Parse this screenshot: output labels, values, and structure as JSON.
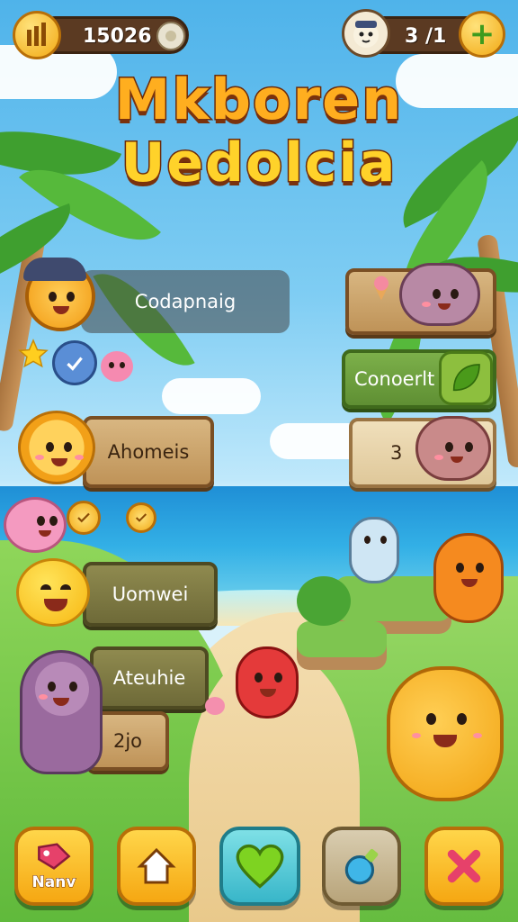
{
  "hud": {
    "coins": "15026",
    "lives": "3 /1",
    "add_symbol": "+",
    "bars_icon": "bars-icon",
    "coin_icon": "coin-icon",
    "avatar_icon": "cat-avatar-icon"
  },
  "title": {
    "line1": "Mkboren",
    "line2": "Uedolcia"
  },
  "menu_left": [
    {
      "label": "Codapnaig"
    },
    {
      "label": "Ahomeis"
    },
    {
      "label": "Uomwei"
    },
    {
      "label": "Ateuhie"
    },
    {
      "label": "2jo"
    }
  ],
  "menu_right": [
    {
      "label": ""
    },
    {
      "label": "Conoerlt"
    },
    {
      "label": "3"
    }
  ],
  "bottom_bar": {
    "new_label": "Nanv",
    "buttons": [
      "new-button",
      "home-button",
      "heart-button",
      "potion-button",
      "close-button"
    ]
  },
  "colors": {
    "sky": "#4fb3ea",
    "wood": "#bf9358",
    "gold": "#f2a915",
    "title_orange": "#ffae1f"
  }
}
